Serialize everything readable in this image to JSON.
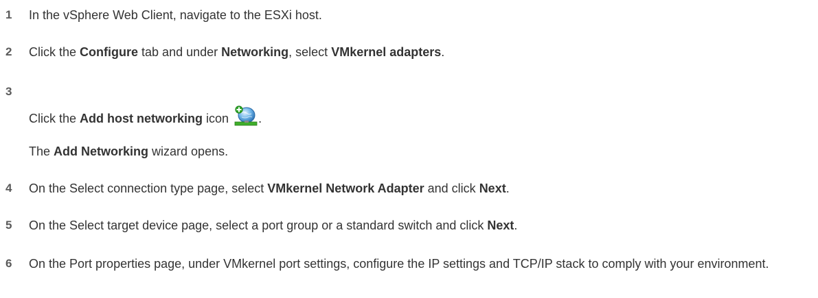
{
  "steps": [
    {
      "num": "1",
      "parts": [
        {
          "t": "In the vSphere Web Client, navigate to the ESXi host.",
          "b": false
        }
      ]
    },
    {
      "num": "2",
      "parts": [
        {
          "t": "Click the ",
          "b": false
        },
        {
          "t": "Configure",
          "b": true
        },
        {
          "t": " tab and under ",
          "b": false
        },
        {
          "t": "Networking",
          "b": true
        },
        {
          "t": ", select ",
          "b": false
        },
        {
          "t": "VMkernel adapters",
          "b": true
        },
        {
          "t": ".",
          "b": false
        }
      ]
    },
    {
      "num": "3",
      "parts": [
        {
          "t": "Click the ",
          "b": false
        },
        {
          "t": "Add host networking",
          "b": true
        },
        {
          "t": " icon ",
          "b": false
        }
      ],
      "icon": "add-host-networking-icon",
      "trailing": ".",
      "note": [
        {
          "t": "The ",
          "b": false
        },
        {
          "t": "Add Networking",
          "b": true
        },
        {
          "t": " wizard opens.",
          "b": false
        }
      ]
    },
    {
      "num": "4",
      "parts": [
        {
          "t": "On the Select connection type page, select ",
          "b": false
        },
        {
          "t": "VMkernel Network Adapter",
          "b": true
        },
        {
          "t": " and click ",
          "b": false
        },
        {
          "t": "Next",
          "b": true
        },
        {
          "t": ".",
          "b": false
        }
      ]
    },
    {
      "num": "5",
      "parts": [
        {
          "t": "On the Select target device page, select a port group or a standard switch and click ",
          "b": false
        },
        {
          "t": "Next",
          "b": true
        },
        {
          "t": ".",
          "b": false
        }
      ]
    },
    {
      "num": "6",
      "parts": [
        {
          "t": "On the Port properties page, under VMkernel port settings, configure the IP settings and TCP/IP stack to comply with your environment.",
          "b": false
        }
      ]
    }
  ]
}
